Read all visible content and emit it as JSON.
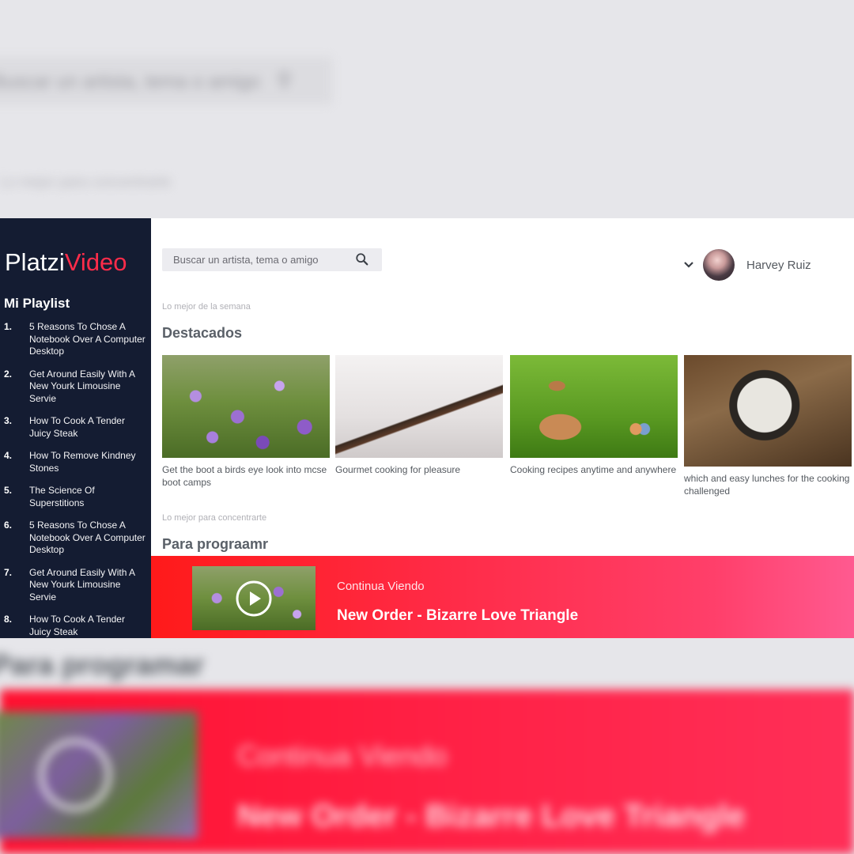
{
  "background": {
    "search_placeholder": "Buscar un artista, tema o amigo",
    "caption": "Lo mejor para concentrarte",
    "heading": "Para programar",
    "continue_label": "Continua Viendo",
    "song": "New Order - Bizarre Love Triangle"
  },
  "logo": {
    "part1": "Platzi",
    "part2": "Video"
  },
  "sidebar": {
    "title": "Mi Playlist",
    "items": [
      {
        "num": "1.",
        "label": "5 Reasons To Chose A Notebook Over A Computer Desktop"
      },
      {
        "num": "2.",
        "label": "Get Around Easily With A New Yourk Limousine Servie"
      },
      {
        "num": "3.",
        "label": "How To Cook A Tender Juicy Steak"
      },
      {
        "num": "4.",
        "label": "How To Remove Kindney Stones"
      },
      {
        "num": "5.",
        "label": "The Science Of Superstitions"
      },
      {
        "num": "6.",
        "label": "5 Reasons To Chose A Notebook Over A Computer Desktop"
      },
      {
        "num": "7.",
        "label": "Get Around Easily With A New Yourk Limousine Servie"
      },
      {
        "num": "8.",
        "label": "How To Cook A Tender Juicy Steak"
      }
    ]
  },
  "search": {
    "placeholder": "Buscar un artista, tema o amigo"
  },
  "user": {
    "name": "Harvey Ruiz"
  },
  "sections": {
    "featured_sub": "Lo mejor de la semana",
    "featured_title": "Destacados",
    "focus_sub": "Lo mejor para concentrarte",
    "focus_title": "Para prograamr"
  },
  "cards": [
    {
      "caption": "Get the boot a birds eye look into mcse boot camps",
      "image": "purple-crocus-flowers"
    },
    {
      "caption": "Gourmet cooking for pleasure",
      "image": "puzzle-pieces"
    },
    {
      "caption": "Cooking recipes anytime and anywhere",
      "image": "bunny-in-grass"
    },
    {
      "caption": "which and easy lunches for the cooking challenged",
      "image": "pocket-watch"
    }
  ],
  "player": {
    "label": "Continua Viendo",
    "song": "New Order - Bizarre Love Triangle"
  },
  "colors": {
    "sidebar": "#141c32",
    "accent": "#ff2c4a",
    "bar_start": "#ff1a1a",
    "bar_end": "#ff5a90"
  }
}
